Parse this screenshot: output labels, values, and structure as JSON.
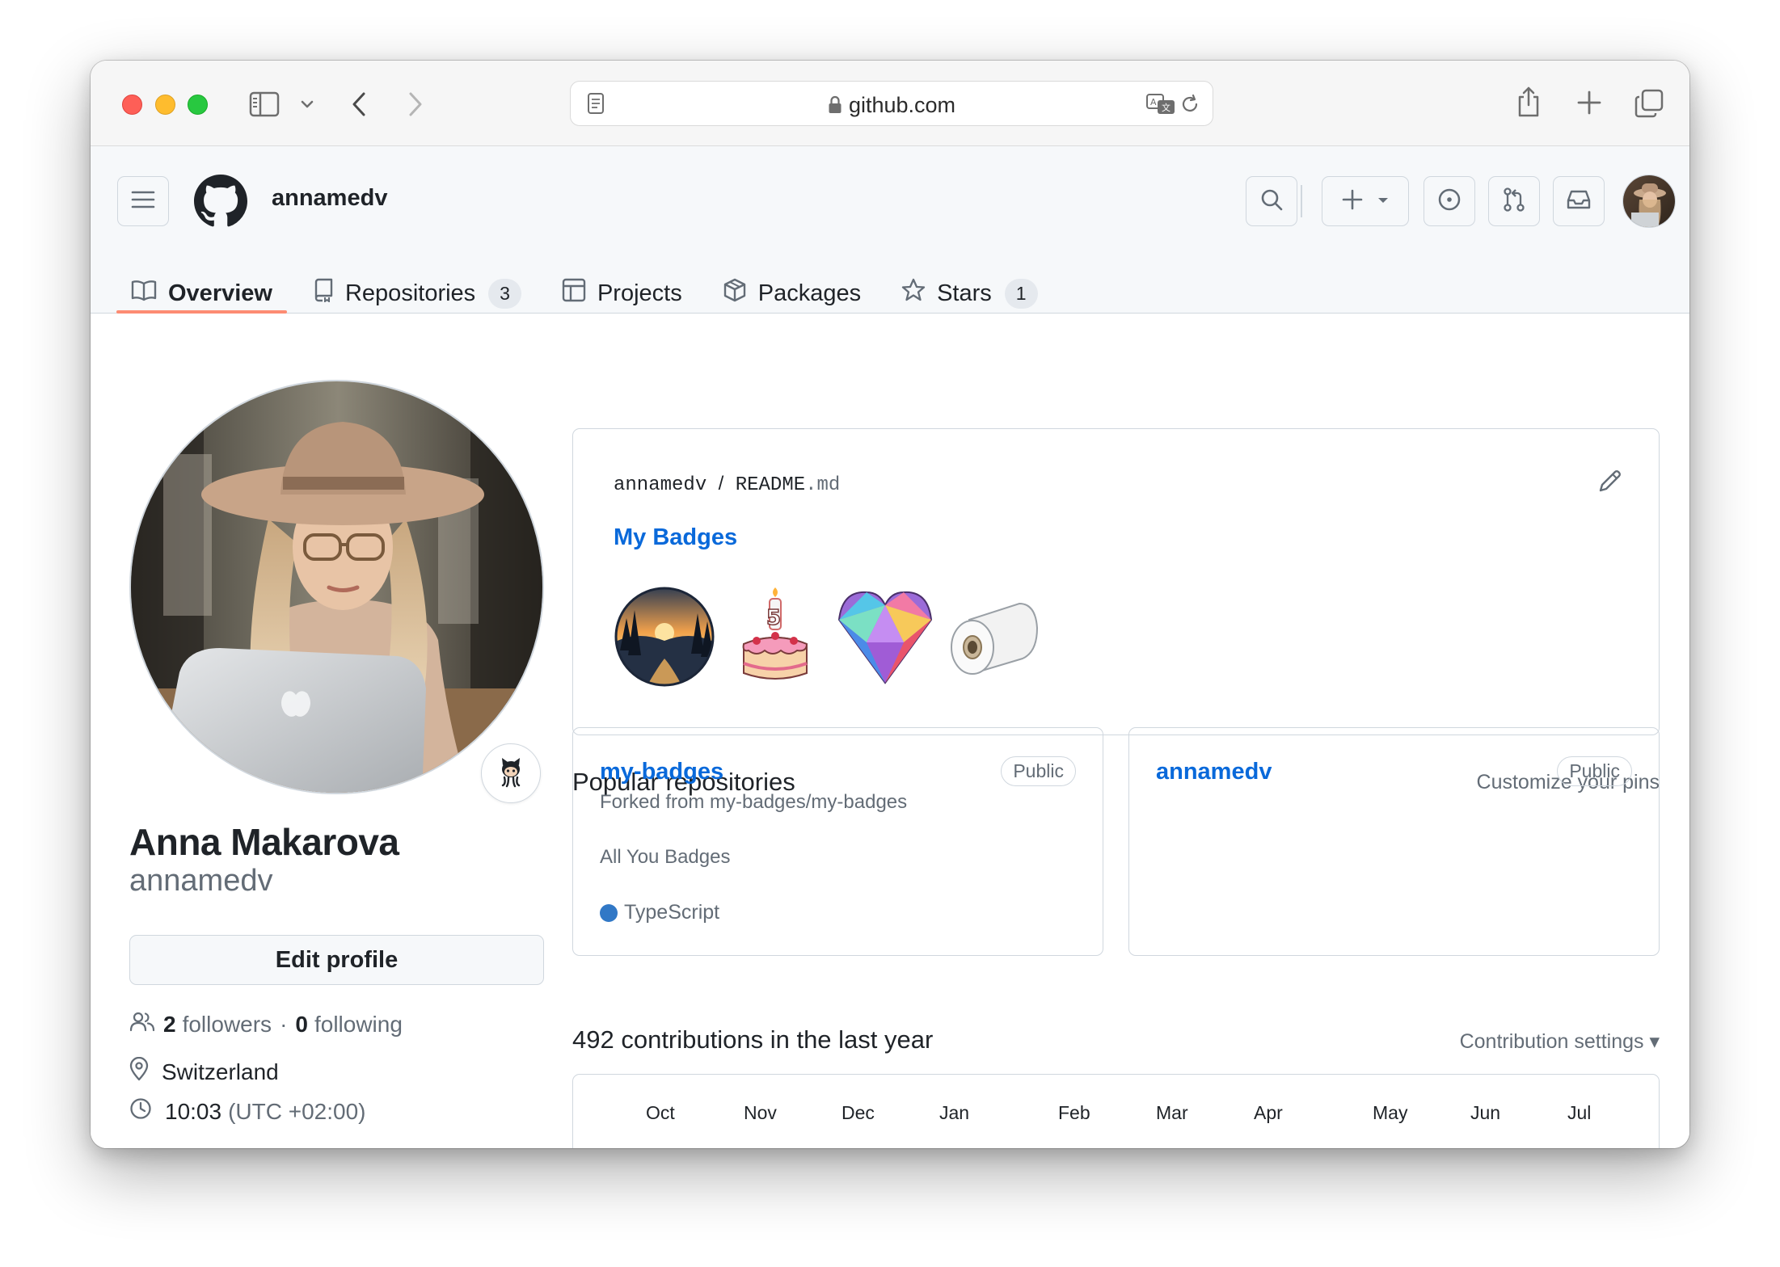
{
  "browser": {
    "url": "github.com"
  },
  "header": {
    "owner": "annamedv"
  },
  "tabs": [
    {
      "label": "Overview"
    },
    {
      "label": "Repositories",
      "count": "3"
    },
    {
      "label": "Projects"
    },
    {
      "label": "Packages"
    },
    {
      "label": "Stars",
      "count": "1"
    }
  ],
  "profile": {
    "full_name": "Anna Makarova",
    "login": "annamedv",
    "edit_label": "Edit profile",
    "followers_count": "2",
    "followers_label": "followers",
    "separator": "·",
    "following_count": "0",
    "following_label": "following",
    "location": "Switzerland",
    "time": "10:03",
    "timezone": "(UTC +02:00)"
  },
  "readme": {
    "owner": "annamedv",
    "slash": "/",
    "file": "README",
    "ext": ".md",
    "title": "My Badges",
    "badges": [
      "landscape-badge",
      "birthday-cake-badge",
      "diamond-heart-badge",
      "toilet-paper-badge"
    ]
  },
  "popular": {
    "title": "Popular repositories",
    "customize": "Customize your pins",
    "repos": [
      {
        "name": "my-badges",
        "visibility": "Public",
        "fork": "Forked from my-badges/my-badges",
        "description": "All You Badges",
        "language": "TypeScript",
        "language_color": "#3178c6"
      },
      {
        "name": "annamedv",
        "visibility": "Public"
      }
    ]
  },
  "contributions": {
    "title": "492 contributions in the last year",
    "settings": "Contribution settings ▾",
    "months": [
      "Oct",
      "Nov",
      "Dec",
      "Jan",
      "Feb",
      "Mar",
      "Apr",
      "May",
      "Jun",
      "Jul"
    ]
  },
  "colors": {
    "accent_link": "#0969da",
    "tab_underline": "#fd8c73",
    "border": "#d0d7de"
  }
}
